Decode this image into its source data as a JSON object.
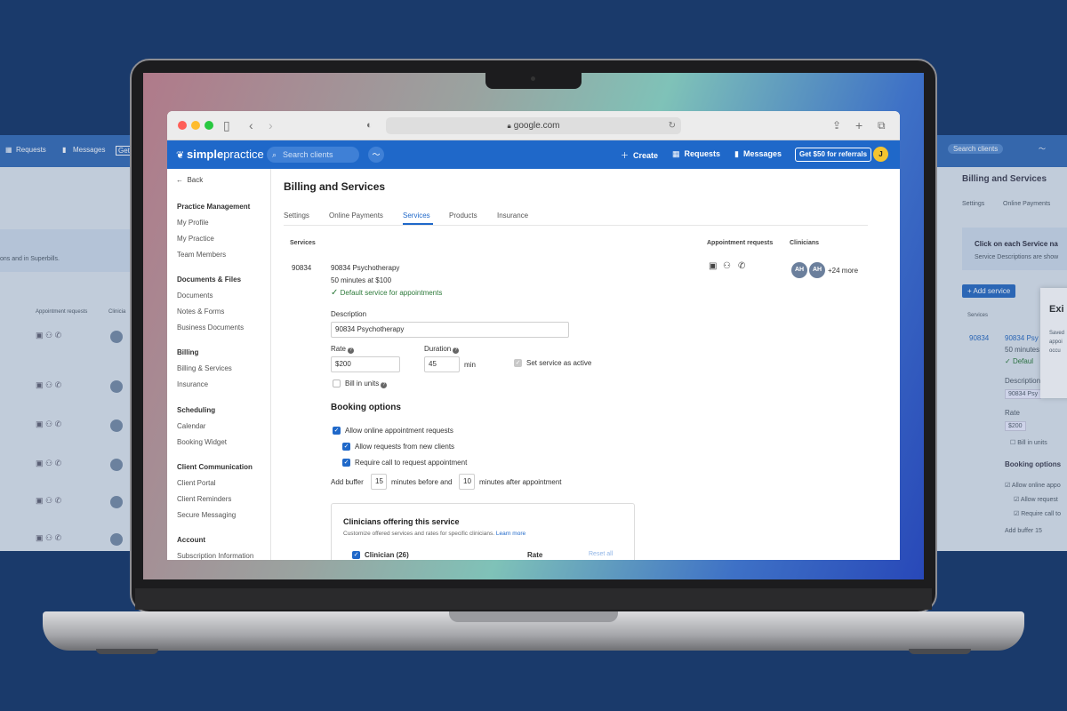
{
  "ghost_left": {
    "nav": [
      "Requests",
      "Messages",
      "Get"
    ],
    "band_text": "ons and in Superbills.",
    "col_appointment": "Appointment requests",
    "col_clinicians": "Clinicia"
  },
  "ghost_right": {
    "search": "Search clients",
    "title": "Billing and Services",
    "tabs": [
      "Settings",
      "Online Payments"
    ],
    "band_title": "Click on each Service na",
    "band_sub": "Service Descriptions are show",
    "add_service": "+ Add service",
    "col_services": "Services",
    "code": "90834",
    "service_name": "90834 Psy",
    "duration": "50 minutes",
    "default": "Defaul",
    "description_label": "Description",
    "description_value": "90834 Psy",
    "rate_label": "Rate",
    "rate_value": "$200",
    "bill_units": "Bill in units",
    "booking": "Booking options",
    "allow_online": "Allow online appo",
    "allow_requests": "Allow request",
    "require_call": "Require call to",
    "add_buffer": "Add buffer",
    "buffer_value": "15",
    "modal_title": "Exi",
    "modal_text": [
      "Saved",
      "appoi",
      "occu"
    ]
  },
  "browser": {
    "url": "google.com"
  },
  "appbar": {
    "logo_bold": "simple",
    "logo_light": "practice",
    "search_placeholder": "Search clients",
    "create": "Create",
    "requests": "Requests",
    "messages": "Messages",
    "referral": "Get $50 for referrals",
    "user_initial": "J"
  },
  "sidebar": {
    "back": "Back",
    "sections": [
      {
        "title": "Practice Management",
        "items": [
          "My Profile",
          "My Practice",
          "Team Members"
        ]
      },
      {
        "title": "Documents & Files",
        "items": [
          "Documents",
          "Notes & Forms",
          "Business Documents"
        ]
      },
      {
        "title": "Billing",
        "items": [
          "Billing & Services",
          "Insurance"
        ]
      },
      {
        "title": "Scheduling",
        "items": [
          "Calendar",
          "Booking Widget"
        ]
      },
      {
        "title": "Client Communication",
        "items": [
          "Client Portal",
          "Client Reminders",
          "Secure Messaging"
        ]
      },
      {
        "title": "Account",
        "items": [
          "Subscription Information"
        ]
      }
    ]
  },
  "main": {
    "title": "Billing and Services",
    "tabs": [
      "Settings",
      "Online Payments",
      "Services",
      "Products",
      "Insurance"
    ],
    "active_tab": "Services",
    "columns": {
      "services": "Services",
      "appointment_requests": "Appointment requests",
      "clinicians": "Clinicians"
    },
    "service": {
      "code": "90834",
      "name": "90834 Psychotherapy",
      "duration_rate": "50 minutes at $100",
      "default": "Default service for appointments",
      "clinician_avatars": [
        "AH",
        "AH"
      ],
      "more": "+24 more"
    },
    "form": {
      "description_label": "Description",
      "description_value": "90834 Psychotherapy",
      "rate_label": "Rate",
      "rate_value": "$200",
      "duration_label": "Duration",
      "duration_value": "45",
      "duration_unit": "min",
      "active_label": "Set service as active",
      "bill_units": "Bill in units"
    },
    "booking": {
      "title": "Booking options",
      "allow_online": "Allow online appointment requests",
      "allow_new": "Allow requests from new clients",
      "require_call": "Require call to request appointment",
      "buffer_prefix": "Add buffer",
      "buffer_before": "15",
      "buffer_mid": "minutes before and",
      "buffer_after": "10",
      "buffer_suffix": "minutes after appointment"
    },
    "clinicians_card": {
      "title": "Clinicians offering this service",
      "subtitle": "Customize offered services and rates for specific clinicians.",
      "learn_more": "Learn more",
      "clinician_header": "Clinician (26)",
      "rate_header": "Rate",
      "reset_all": "Reset all"
    }
  },
  "colors": {
    "brand": "#1f68c9",
    "background": "#1a3a6b",
    "success": "#2d7a3a"
  }
}
